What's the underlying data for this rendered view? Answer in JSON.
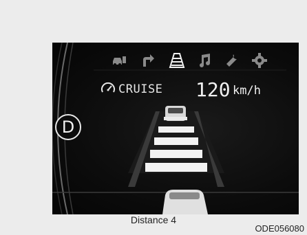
{
  "cluster": {
    "gear": "D",
    "cruise_label": "CRUISE",
    "set_speed": "120",
    "speed_unit": "km/h",
    "distance_level": 4,
    "top_icons": [
      "vehicle-settings-icon",
      "turn-arrow-icon",
      "lane-icon",
      "music-note-icon",
      "wrench-icon",
      "gear-icon"
    ],
    "active_icon": "lane-icon"
  },
  "caption": "Distance 4",
  "figure_code": "ODE056080",
  "colors": {
    "display_bg": "#0c0c0c",
    "foreground": "#e6e6e6",
    "inactive_icon": "#8a8a8a"
  }
}
